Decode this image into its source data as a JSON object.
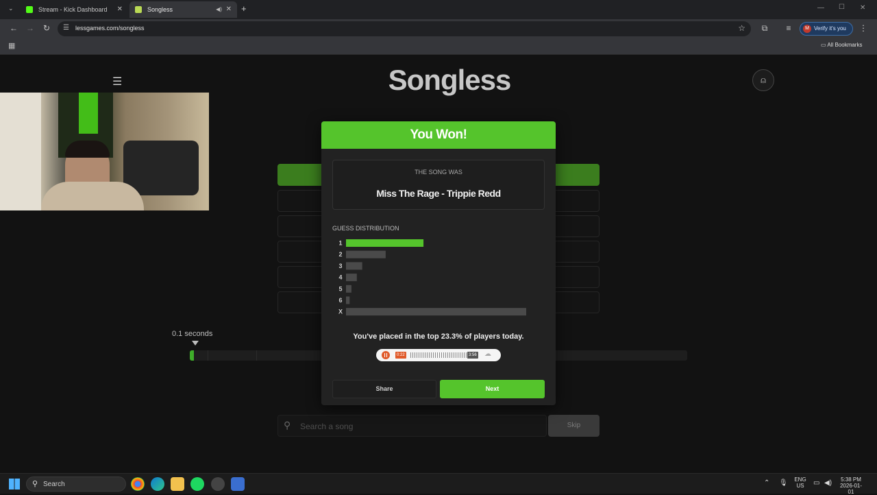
{
  "browser": {
    "tabs": [
      {
        "label": "Stream - Kick Dashboard",
        "favicon_color": "#53fc18"
      },
      {
        "label": "Songless",
        "favicon_color": "#bada55"
      }
    ],
    "url": "lessgames.com/songless",
    "verify_label": "Verify it's you",
    "profile_initial": "M",
    "bookmarks_label": "All Bookmarks"
  },
  "page": {
    "logo": "Songless",
    "timer_label": "0.1 seconds",
    "search_placeholder": "Search a song",
    "skip_label": "Skip"
  },
  "modal": {
    "title": "You Won!",
    "song_label": "THE SONG WAS",
    "song_title": "Miss The Rage - Trippie Redd",
    "distribution_label": "GUESS DISTRIBUTION",
    "placed_text": "You've placed in the top 23.3% of players today.",
    "player": {
      "elapsed": "0:22",
      "duration": "3:56"
    },
    "share_label": "Share",
    "next_label": "Next"
  },
  "chart_data": {
    "type": "bar",
    "orientation": "horizontal",
    "categories": [
      "1",
      "2",
      "3",
      "4",
      "5",
      "6",
      "X"
    ],
    "values": [
      43,
      22,
      9,
      6,
      3,
      2,
      100
    ],
    "highlight_index": 0,
    "colors": {
      "highlight": "#55c42c",
      "default": "#4a4a4a"
    },
    "title": "",
    "xlabel": "",
    "ylabel": ""
  },
  "taskbar": {
    "search_label": "Search",
    "lang_top": "ENG",
    "lang_bottom": "US",
    "time": "5:38 PM",
    "date": "2026-01-01"
  },
  "colors": {
    "accent": "#55c42c",
    "background": "#121212",
    "modal": "#222222"
  }
}
